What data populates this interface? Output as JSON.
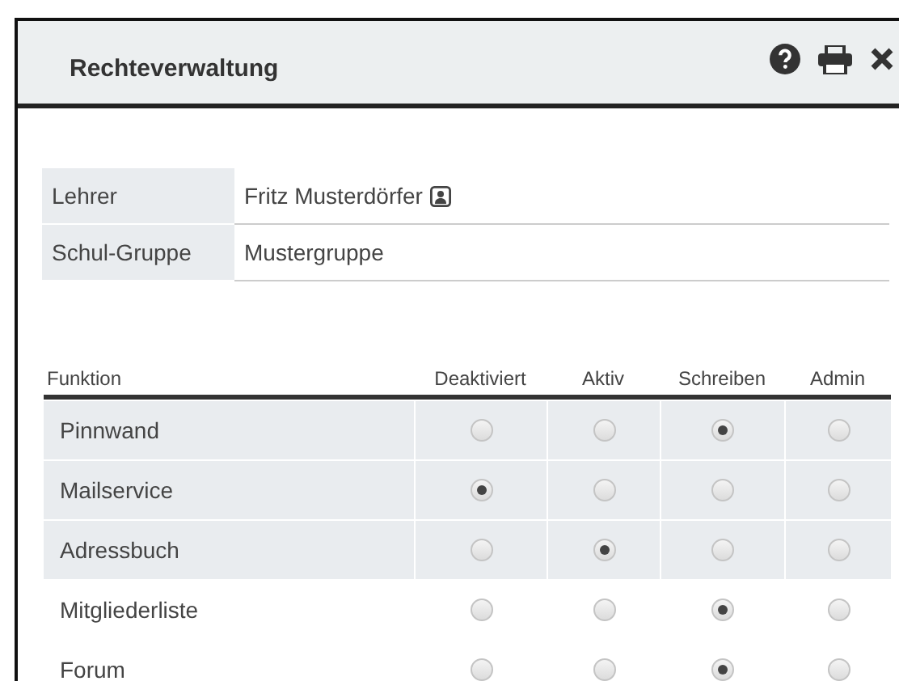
{
  "window": {
    "title": "Rechteverwaltung"
  },
  "info": [
    {
      "label": "Lehrer",
      "value": "Fritz Musterdörfer",
      "contact_icon": true
    },
    {
      "label": "Schul-Gruppe",
      "value": "Mustergruppe",
      "contact_icon": false
    }
  ],
  "table": {
    "columns": [
      "Funktion",
      "Deaktiviert",
      "Aktiv",
      "Schreiben",
      "Admin"
    ],
    "rows": [
      {
        "name": "Pinnwand",
        "highlighted": true,
        "options": [
          {
            "selected": false
          },
          {
            "selected": false
          },
          {
            "selected": true
          },
          {
            "selected": false
          }
        ]
      },
      {
        "name": "Mailservice",
        "highlighted": true,
        "options": [
          {
            "selected": true
          },
          {
            "selected": false
          },
          {
            "selected": false
          },
          {
            "selected": false
          }
        ]
      },
      {
        "name": "Adressbuch",
        "highlighted": true,
        "options": [
          {
            "selected": false
          },
          {
            "selected": true
          },
          {
            "selected": false
          },
          {
            "selected": false
          }
        ]
      },
      {
        "name": "Mitgliederliste",
        "highlighted": false,
        "options": [
          {
            "selected": false
          },
          {
            "selected": false
          },
          {
            "selected": true
          },
          {
            "selected": false
          }
        ]
      },
      {
        "name": "Forum",
        "highlighted": false,
        "options": [
          {
            "selected": false
          },
          {
            "selected": false
          },
          {
            "selected": true
          },
          {
            "selected": false
          }
        ]
      }
    ]
  }
}
